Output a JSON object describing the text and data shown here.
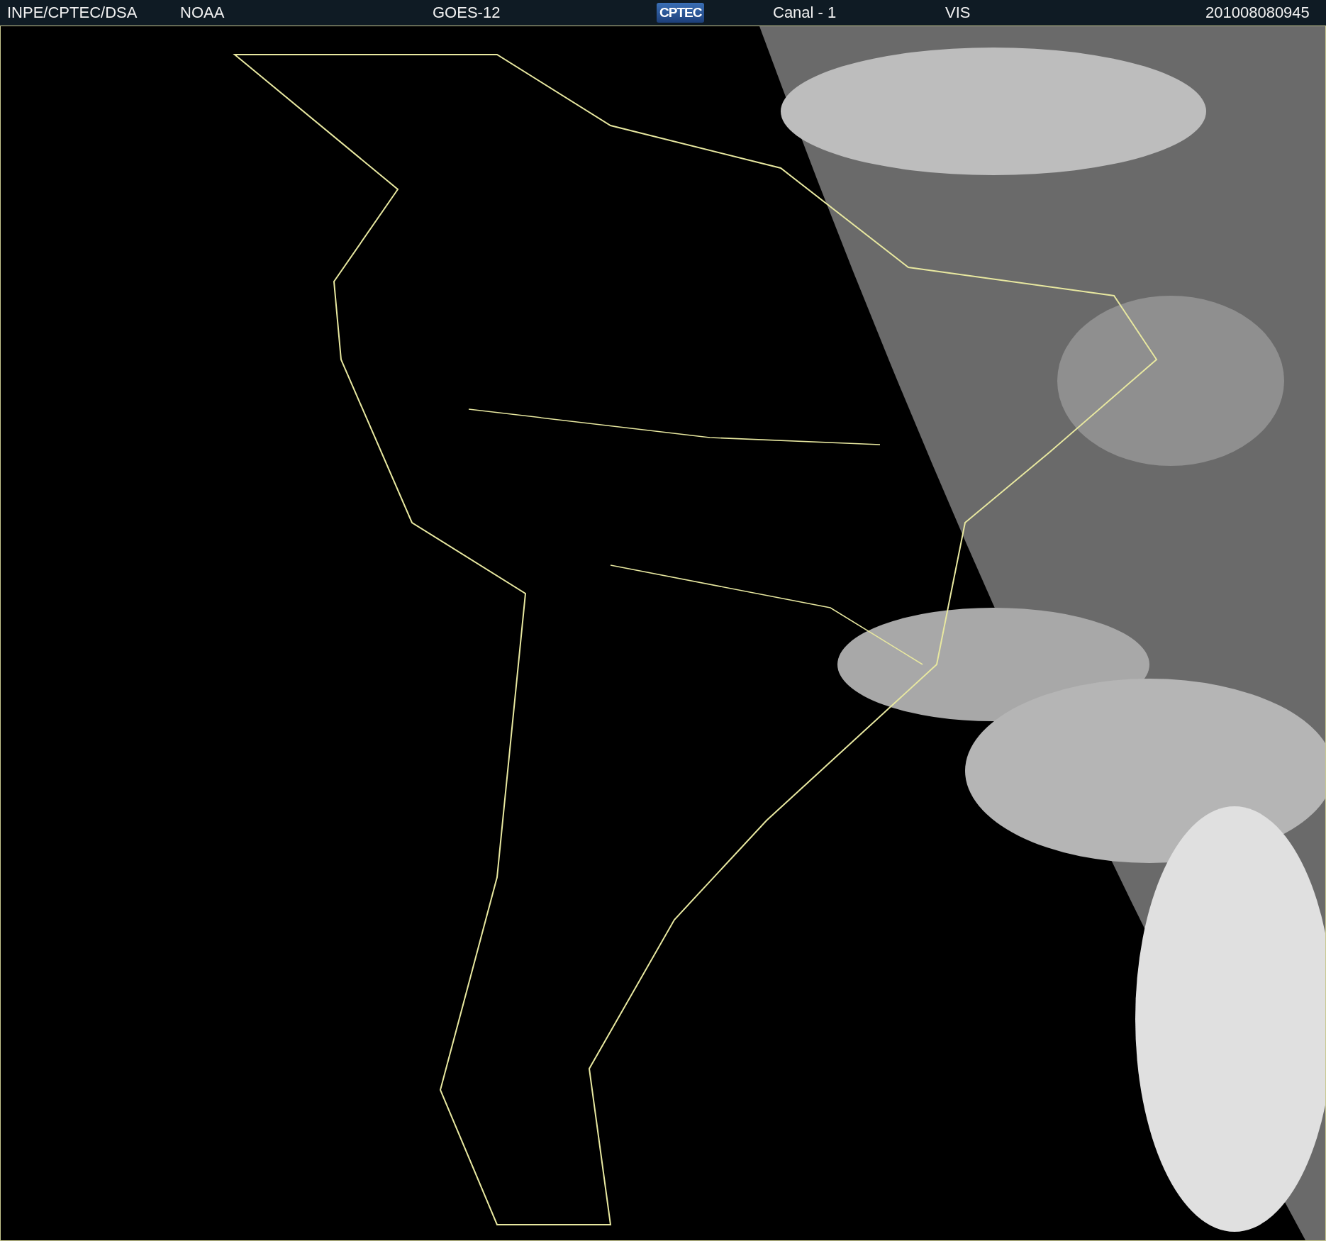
{
  "header": {
    "items": [
      "INPE/CPTEC/DSA",
      "NOAA",
      "GOES-12"
    ],
    "logo": "CPTEC",
    "channel": "Canal - 1",
    "band": "VIS",
    "timestamp": "201008080945"
  }
}
